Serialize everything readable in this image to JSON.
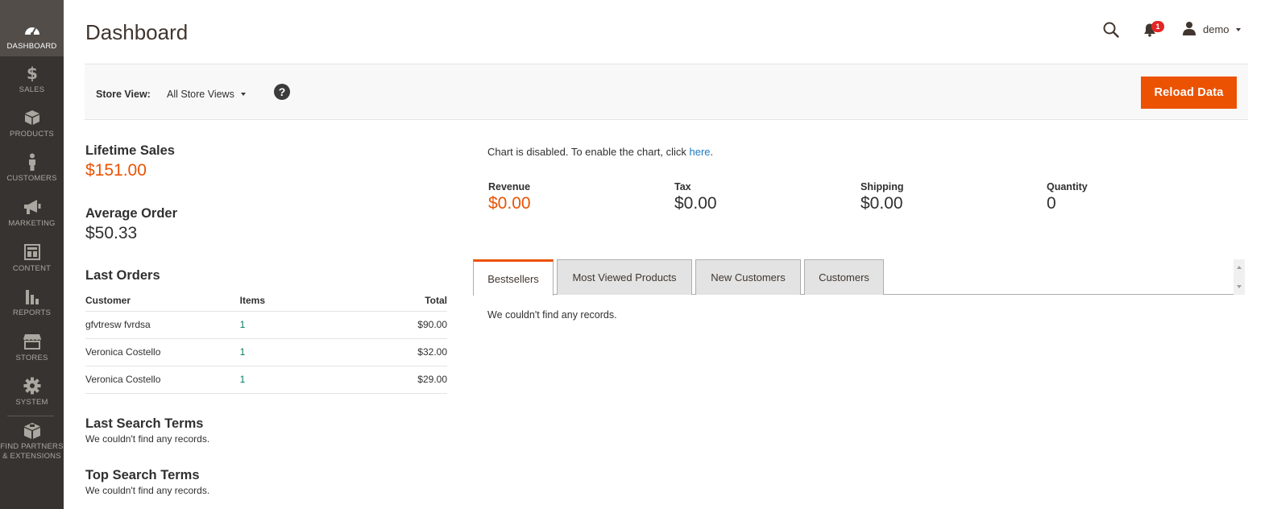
{
  "sidebar": {
    "items": [
      {
        "label": "DASHBOARD",
        "icon": "dashboard-icon"
      },
      {
        "label": "SALES",
        "icon": "dollar-icon"
      },
      {
        "label": "PRODUCTS",
        "icon": "box-icon"
      },
      {
        "label": "CUSTOMERS",
        "icon": "person-icon"
      },
      {
        "label": "MARKETING",
        "icon": "megaphone-icon"
      },
      {
        "label": "CONTENT",
        "icon": "layout-icon"
      },
      {
        "label": "REPORTS",
        "icon": "bar-chart-icon"
      },
      {
        "label": "STORES",
        "icon": "store-icon"
      },
      {
        "label": "SYSTEM",
        "icon": "gear-icon"
      },
      {
        "label_line1": "FIND PARTNERS",
        "label_line2": "& EXTENSIONS",
        "icon": "extensions-icon"
      }
    ]
  },
  "header": {
    "title": "Dashboard",
    "notification_count": "1",
    "user_name": "demo"
  },
  "store_bar": {
    "label": "Store View:",
    "selected": "All Store Views",
    "help": "?",
    "reload_label": "Reload Data"
  },
  "lifetime_sales": {
    "title": "Lifetime Sales",
    "value": "$151.00"
  },
  "average_order": {
    "title": "Average Order",
    "value": "$50.33"
  },
  "last_orders": {
    "title": "Last Orders",
    "columns": [
      "Customer",
      "Items",
      "Total"
    ],
    "rows": [
      {
        "customer": "gfvtresw fvrdsa",
        "items": "1",
        "total": "$90.00"
      },
      {
        "customer": "Veronica Costello",
        "items": "1",
        "total": "$32.00"
      },
      {
        "customer": "Veronica Costello",
        "items": "1",
        "total": "$29.00"
      }
    ]
  },
  "last_search_terms": {
    "title": "Last Search Terms",
    "empty": "We couldn't find any records."
  },
  "top_search_terms": {
    "title": "Top Search Terms",
    "empty": "We couldn't find any records."
  },
  "chart_notice": {
    "text": "Chart is disabled. To enable the chart, click ",
    "link": "here",
    "end": "."
  },
  "metrics": [
    {
      "label": "Revenue",
      "value": "$0.00"
    },
    {
      "label": "Tax",
      "value": "$0.00"
    },
    {
      "label": "Shipping",
      "value": "$0.00"
    },
    {
      "label": "Quantity",
      "value": "0"
    }
  ],
  "tabs": [
    {
      "label": "Bestsellers",
      "active": true
    },
    {
      "label": "Most Viewed Products",
      "active": false
    },
    {
      "label": "New Customers",
      "active": false
    },
    {
      "label": "Customers",
      "active": false
    }
  ],
  "tab_content": {
    "empty": "We couldn't find any records."
  },
  "colors": {
    "accent": "#eb5202",
    "sidebar": "#373330",
    "link": "#1979c3"
  }
}
